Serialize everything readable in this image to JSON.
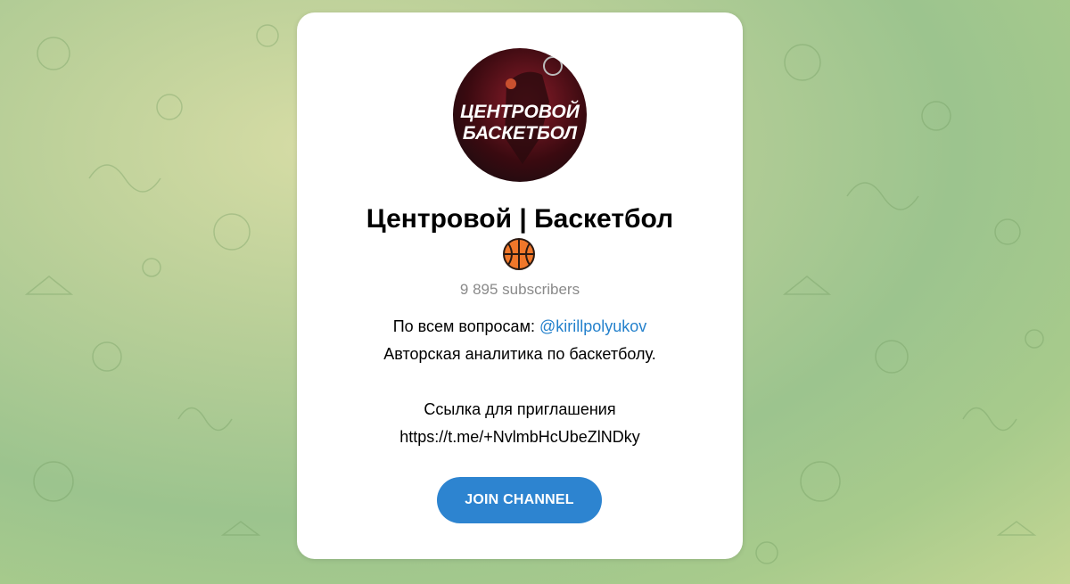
{
  "channel": {
    "title": "Центровой | Баскетбол",
    "title_emoji": "basketball-icon",
    "subscribers": "9 895 subscribers",
    "avatar_text_line1": "ЦЕНТРОВОЙ",
    "avatar_text_line2": "БАСКЕТБОЛ",
    "description": {
      "line1_prefix": "По всем вопросам: ",
      "line1_link": "@kirillpolyukov",
      "line2": "Авторская аналитика по баскетболу.",
      "line3": "",
      "line4": "Ссылка для приглашения",
      "line5": "https://t.me/+NvlmbHcUbeZlNDky"
    },
    "join_label": "JOIN CHANNEL"
  },
  "colors": {
    "accent": "#2d84d0",
    "link": "#2481cc",
    "muted": "#8a8a8a"
  }
}
